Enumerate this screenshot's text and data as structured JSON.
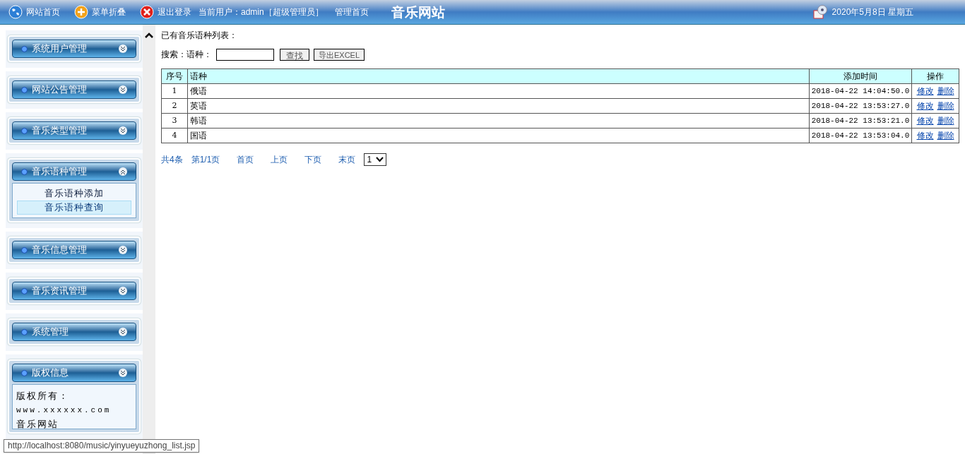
{
  "top_bar": {
    "links": [
      {
        "kind": "globe",
        "label": "网站首页"
      },
      {
        "kind": "plus",
        "label": "菜单折叠"
      },
      {
        "kind": "close",
        "label": "退出登录"
      }
    ],
    "current_user": "当前用户：admin［超级管理员］",
    "admin_home": "管理首页",
    "site_title": "音乐网站",
    "date": "2020年5月8日 星期五"
  },
  "sidebar": {
    "groups": [
      {
        "kind": "menu",
        "title": "系统用户管理",
        "expanded": false
      },
      {
        "kind": "menu",
        "title": "网站公告管理",
        "expanded": false
      },
      {
        "kind": "menu",
        "title": "音乐类型管理",
        "expanded": false
      },
      {
        "kind": "menu",
        "title": "音乐语种管理",
        "expanded": true,
        "children": [
          {
            "label": "音乐语种添加",
            "selected": false
          },
          {
            "label": "音乐语种查询",
            "selected": true
          }
        ]
      },
      {
        "kind": "menu",
        "title": "音乐信息管理",
        "expanded": false
      },
      {
        "kind": "menu",
        "title": "音乐资讯管理",
        "expanded": false
      },
      {
        "kind": "menu",
        "title": "系统管理",
        "expanded": false
      },
      {
        "kind": "info",
        "title": "版权信息",
        "expanded": false,
        "lines": [
          "版权所有：",
          "www.xxxxxx.com",
          "音乐网站"
        ]
      }
    ]
  },
  "content": {
    "heading": "已有音乐语种列表：",
    "search": {
      "label": "搜索：语种：",
      "find_button": "查找",
      "export_button": "导出EXCEL"
    },
    "table": {
      "columns": [
        "序号",
        "语种",
        "添加时间",
        "操作"
      ],
      "rows": [
        {
          "no": "1",
          "language": "俄语",
          "time": "2018-04-22 14:04:50.0",
          "actions": [
            "修改",
            "删除"
          ]
        },
        {
          "no": "2",
          "language": "英语",
          "time": "2018-04-22 13:53:27.0",
          "actions": [
            "修改",
            "删除"
          ]
        },
        {
          "no": "3",
          "language": "韩语",
          "time": "2018-04-22 13:53:21.0",
          "actions": [
            "修改",
            "删除"
          ]
        },
        {
          "no": "4",
          "language": "国语",
          "time": "2018-04-22 13:53:04.0",
          "actions": [
            "修改",
            "删除"
          ]
        }
      ]
    },
    "pagination": {
      "total": "共4条",
      "page": "第1/1页",
      "links": [
        "首页",
        "上页",
        "下页",
        "末页"
      ],
      "page_select": "1"
    }
  },
  "status_tooltip": "http://localhost:8080/music/yinyueyuzhong_list.jsp"
}
